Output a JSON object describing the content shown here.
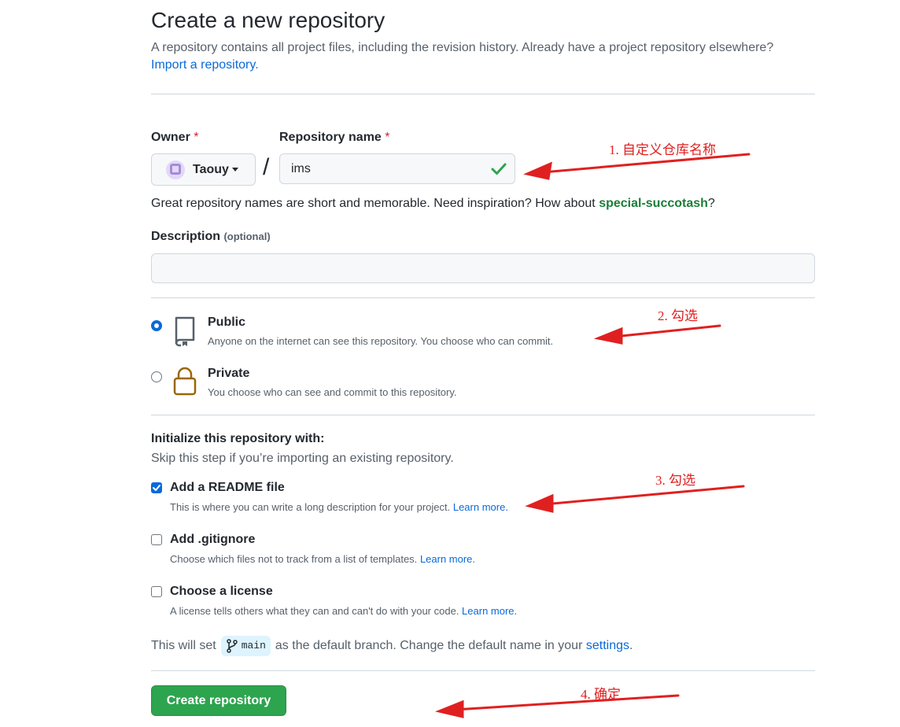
{
  "header": {
    "title": "Create a new repository",
    "subtitle": "A repository contains all project files, including the revision history. Already have a project repository elsewhere?",
    "import_link": "Import a repository."
  },
  "owner": {
    "label": "Owner",
    "required_mark": "*",
    "name": "Taouy"
  },
  "repo_name": {
    "label": "Repository name",
    "required_mark": "*",
    "value": "ims",
    "separator": "/"
  },
  "hint": {
    "text": "Great repository names are short and memorable. Need inspiration? How about",
    "suggestion": "special-succotash",
    "end": "?"
  },
  "description": {
    "label": "Description",
    "optional": "(optional)",
    "value": ""
  },
  "visibility": {
    "public": {
      "title": "Public",
      "desc": "Anyone on the internet can see this repository. You choose who can commit.",
      "selected": true
    },
    "private": {
      "title": "Private",
      "desc": "You choose who can see and commit to this repository.",
      "selected": false
    }
  },
  "init": {
    "title": "Initialize this repository with:",
    "subtitle": "Skip this step if you’re importing an existing repository.",
    "readme": {
      "title": "Add a README file",
      "desc": "This is where you can write a long description for your project.",
      "link": "Learn more.",
      "checked": true
    },
    "gitignore": {
      "title": "Add .gitignore",
      "desc": "Choose which files not to track from a list of templates.",
      "link": "Learn more.",
      "checked": false
    },
    "license": {
      "title": "Choose a license",
      "desc": "A license tells others what they can and can't do with your code.",
      "link": "Learn more.",
      "checked": false
    }
  },
  "branch": {
    "prefix": "This will set",
    "name": "main",
    "middle": "as the default branch. Change the default name in your",
    "settings_link": "settings",
    "end": "."
  },
  "submit": {
    "label": "Create repository"
  },
  "annotations": {
    "a1": "1. 自定义仓库名称",
    "a2": "2. 勾选",
    "a3": "3. 勾选",
    "a4": "4. 确定",
    "color": "#e02020"
  },
  "colors": {
    "primary_button": "#2da44e",
    "link": "#0969da",
    "suggestion": "#1a7f37",
    "required": "#cf222e",
    "private_icon": "#9a6700"
  }
}
